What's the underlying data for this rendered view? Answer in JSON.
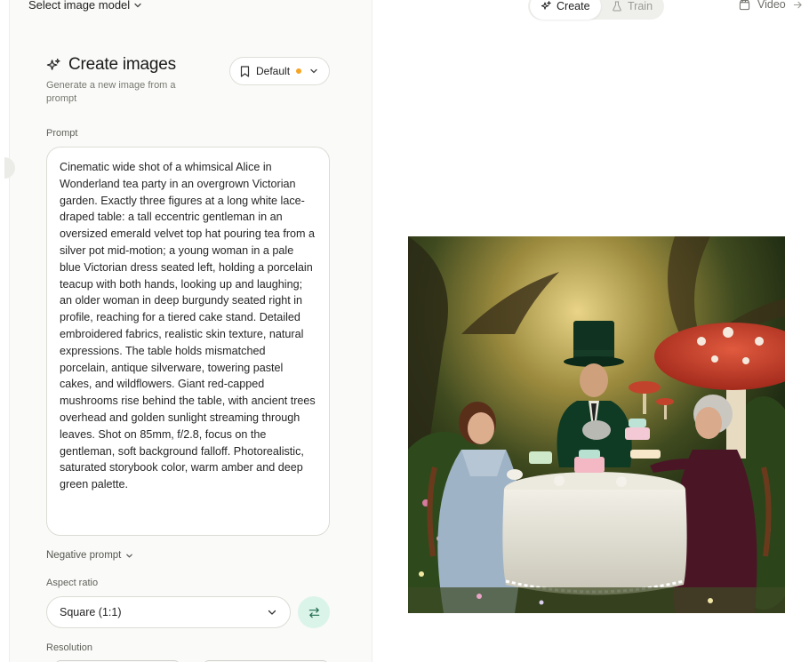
{
  "header": {
    "model_select_label": "Select image model",
    "mode_toggle": {
      "create_label": "Create",
      "train_label": "Train",
      "active": "Create"
    },
    "video_label": "Video"
  },
  "panel": {
    "title": "Create images",
    "subtitle": "Generate a new image from a prompt",
    "preset": {
      "label": "Default",
      "status_color": "#f5a524"
    },
    "prompt": {
      "label": "Prompt",
      "value": "Cinematic wide shot of a whimsical Alice in Wonderland tea party in an overgrown Victorian garden. Exactly three figures at a long white lace-draped table: a tall eccentric gentleman in an oversized emerald velvet top hat pouring tea from a silver pot mid-motion; a young woman in a pale blue Victorian dress seated left, holding a porcelain teacup with both hands, looking up and laughing; an older woman in deep burgundy seated right in profile, reaching for a tiered cake stand. Detailed embroidered fabrics, realistic skin texture, natural expressions. The table holds mismatched porcelain, antique silverware, towering pastel cakes, and wildflowers. Giant red-capped mushrooms rise behind the table, with ancient trees overhead and golden sunlight streaming through leaves. Shot on 85mm, f/2.8, focus on the gentleman, soft background falloff. Photorealistic, saturated storybook color, warm amber and deep green palette."
    },
    "negative_prompt_label": "Negative prompt",
    "aspect_ratio": {
      "label": "Aspect ratio",
      "value": "Square (1:1)"
    },
    "resolution_label": "Resolution"
  },
  "icons": {
    "model_chevron": "chevron-down-icon",
    "title_icon": "sparkles-icon",
    "preset_icon": "bookmark-icon",
    "swap_icon": "swap-arrows-icon",
    "video_icon": "clapperboard-icon",
    "train_icon": "flask-icon"
  },
  "colors": {
    "accent_green": "#dbf4ea",
    "preset_dot": "#f5a524"
  }
}
